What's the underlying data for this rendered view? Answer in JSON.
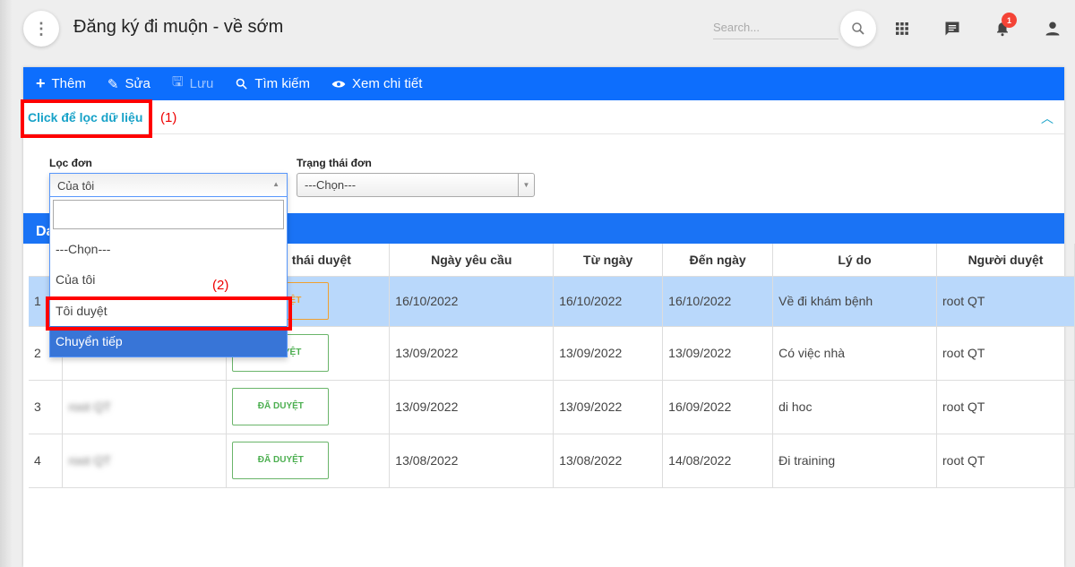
{
  "header": {
    "title": "Đăng ký đi muộn - về sớm",
    "search_placeholder": "Search...",
    "notification_count": "1"
  },
  "toolbar": {
    "add": "Thêm",
    "edit": "Sửa",
    "save": "Lưu",
    "search": "Tìm kiếm",
    "view": "Xem chi tiết"
  },
  "filter": {
    "toggle_label": "Click để lọc dữ liệu",
    "annotation1": "(1)",
    "annotation2": "(2)",
    "loc_don_label": "Lọc đơn",
    "loc_don_value": "Của tôi",
    "trang_thai_label": "Trạng thái đơn",
    "trang_thai_value": "---Chọn---",
    "options": [
      "---Chọn---",
      "Của tôi",
      "Tôi duyệt",
      "Chuyển tiếp"
    ],
    "highlighted_option": "Chuyển tiếp"
  },
  "list": {
    "title": "Da",
    "columns": [
      "",
      "",
      "g thái duyệt",
      "Ngày yêu cầu",
      "Từ ngày",
      "Đến ngày",
      "Lý do",
      "Người duyệt"
    ],
    "rows": [
      {
        "no": "1",
        "name": "",
        "status": "YỆT",
        "status_type": "pending",
        "requested": "16/10/2022",
        "from": "16/10/2022",
        "to": "16/10/2022",
        "reason": "Về đi khám bệnh",
        "approver": "root QT"
      },
      {
        "no": "2",
        "name": "",
        "status": "YỆT",
        "status_type": "approved",
        "requested": "13/09/2022",
        "from": "13/09/2022",
        "to": "13/09/2022",
        "reason": "Có việc nhà",
        "approver": "root QT"
      },
      {
        "no": "3",
        "name": "root QT",
        "status": "ĐÃ DUYỆT",
        "status_type": "approved",
        "requested": "13/09/2022",
        "from": "13/09/2022",
        "to": "16/09/2022",
        "reason": "di hoc",
        "approver": "root QT"
      },
      {
        "no": "4",
        "name": "root QT",
        "status": "ĐÃ DUYỆT",
        "status_type": "approved",
        "requested": "13/08/2022",
        "from": "13/08/2022",
        "to": "14/08/2022",
        "reason": "Đi training",
        "approver": "root QT"
      }
    ]
  },
  "colors": {
    "toolbar": "#0d6efd",
    "accent": "#17a2c8",
    "highlight": "#3875d7",
    "annotation": "#ff0000",
    "badge": "#f44336"
  }
}
